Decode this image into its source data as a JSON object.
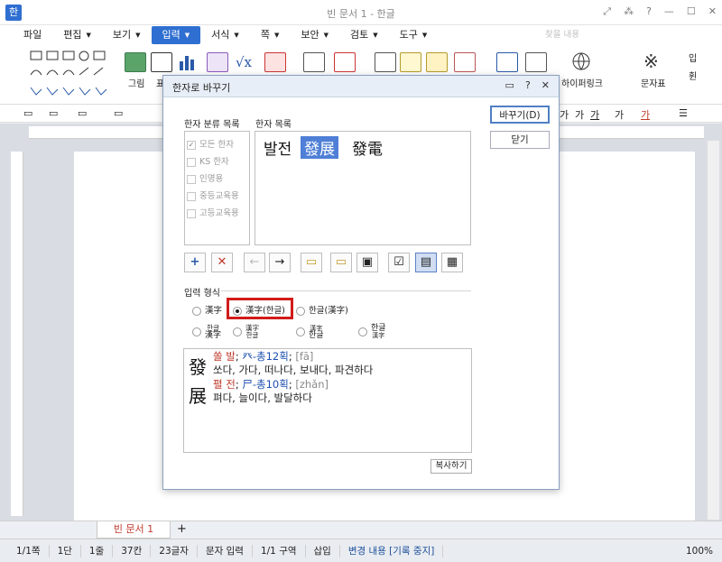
{
  "window": {
    "app_icon": "한",
    "title": "빈 문서 1 - 한글",
    "controls": [
      "⤢",
      "⁂",
      "?",
      "—",
      "☐",
      "✕"
    ]
  },
  "menu": [
    {
      "label": "파일",
      "active": false
    },
    {
      "label": "편집",
      "active": false
    },
    {
      "label": "보기",
      "active": false
    },
    {
      "label": "입력",
      "active": true
    },
    {
      "label": "서식",
      "active": false
    },
    {
      "label": "쪽",
      "active": false
    },
    {
      "label": "보안",
      "active": false
    },
    {
      "label": "검토",
      "active": false
    },
    {
      "label": "도구",
      "active": false
    }
  ],
  "search_placeholder": "찾을 내용",
  "ribbon": {
    "labels": [
      "그림",
      "표",
      "하이퍼링크",
      "문자표",
      "입",
      "휜"
    ]
  },
  "format_bar": {
    "items": [
      "가",
      "가",
      "가",
      "가",
      "가"
    ]
  },
  "dialog": {
    "title": "한자로 바꾸기",
    "controls": [
      "▭",
      "?",
      "✕"
    ],
    "replace_button": "바꾸기(D)",
    "close_button": "닫기",
    "category_label": "한자 분류 목록",
    "list_label": "한자 목록",
    "categories": [
      {
        "label": "모든 한자",
        "checked": true
      },
      {
        "label": "KS 한자",
        "checked": false
      },
      {
        "label": "인명용",
        "checked": false
      },
      {
        "label": "중등교육용",
        "checked": false
      },
      {
        "label": "고등교육용",
        "checked": false
      }
    ],
    "hangul_word": "발전",
    "hanja_options": [
      {
        "label": "發展",
        "selected": true
      },
      {
        "label": "發電",
        "selected": false
      }
    ],
    "icons": [
      "add-icon",
      "delete-icon",
      "back-arrow-icon",
      "forward-arrow-icon",
      "folder-open-icon",
      "folder-icon",
      "save-icon",
      "checklist-icon",
      "convert-icon",
      "grid-icon"
    ],
    "input_format_label": "입력 형식",
    "radio_row1": [
      {
        "label": "漢字",
        "checked": false
      },
      {
        "label": "漢字(한글)",
        "checked": true
      },
      {
        "label": "한글(漢字)",
        "checked": false
      }
    ],
    "radio_row2": [
      {
        "label_top": "한글",
        "label_bottom": "漢字"
      },
      {
        "label_top": "漢字",
        "label_bottom": "한글"
      },
      {
        "label_top": "漢字",
        "label_bottom": "한글"
      },
      {
        "label_top": "한글",
        "label_bottom": "漢字"
      }
    ],
    "definitions": [
      {
        "char": "發",
        "head": "쏠 발",
        "radical": "癶-총12획",
        "pinyin": "[fā]",
        "meaning": "쏘다, 가다, 떠나다, 보내다, 파견하다"
      },
      {
        "char": "展",
        "head": "펼 전",
        "radical": "尸-총10획",
        "pinyin": "[zhǎn]",
        "meaning": "펴다, 늘이다, 발달하다"
      }
    ],
    "copy_button": "복사하기"
  },
  "document_tab": "빈 문서 1",
  "status": [
    {
      "text": "1/1쪽",
      "blue": false
    },
    {
      "text": "1단",
      "blue": false
    },
    {
      "text": "1줄",
      "blue": false
    },
    {
      "text": "37칸",
      "blue": false
    },
    {
      "text": "23글자",
      "blue": false
    },
    {
      "text": "문자 입력",
      "blue": false
    },
    {
      "text": "1/1 구역",
      "blue": false
    },
    {
      "text": "삽입",
      "blue": false
    },
    {
      "text": "변경 내용 [기록 중지]",
      "blue": true
    }
  ],
  "zoom": "100%"
}
